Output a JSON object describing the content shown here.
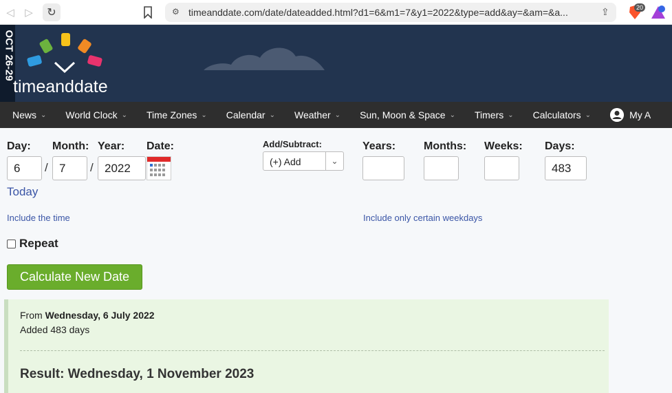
{
  "browser": {
    "url": "timeanddate.com/date/dateadded.html?d1=6&m1=7&y1=2022&type=add&ay=&am=&a...",
    "brave_badge": "20"
  },
  "header": {
    "ribbon_text": "OCT 26-29",
    "logo_text": "timeanddate"
  },
  "menu": {
    "items": [
      "News",
      "World Clock",
      "Time Zones",
      "Calendar",
      "Weather",
      "Sun, Moon & Space",
      "Timers",
      "Calculators"
    ],
    "account_label": "My A"
  },
  "form": {
    "day_label": "Day:",
    "month_label": "Month:",
    "year_label": "Year:",
    "date_label": "Date:",
    "day_value": "6",
    "month_value": "7",
    "year_value": "2022",
    "separator": "/",
    "addsub_label": "Add/Subtract:",
    "addsub_value": "(+) Add",
    "years_label": "Years:",
    "months_label": "Months:",
    "weeks_label": "Weeks:",
    "days_label": "Days:",
    "years_value": "",
    "months_value": "",
    "weeks_value": "",
    "days_value": "483",
    "today_link": "Today",
    "include_time_link": "Include the time",
    "include_weekdays_link": "Include only certain weekdays",
    "repeat_label": "Repeat",
    "calculate_button": "Calculate New Date"
  },
  "result": {
    "from_prefix": "From ",
    "from_date": "Wednesday, 6 July 2022",
    "added_text": "Added 483 days",
    "result_text": "Result: Wednesday, 1 November 2023"
  },
  "colors": {
    "header_bg": "#22344f",
    "menu_bg": "#2e2e2e",
    "button_green": "#6aad2c",
    "link_blue": "#3a55a6",
    "result_bg": "#eaf6e3"
  }
}
